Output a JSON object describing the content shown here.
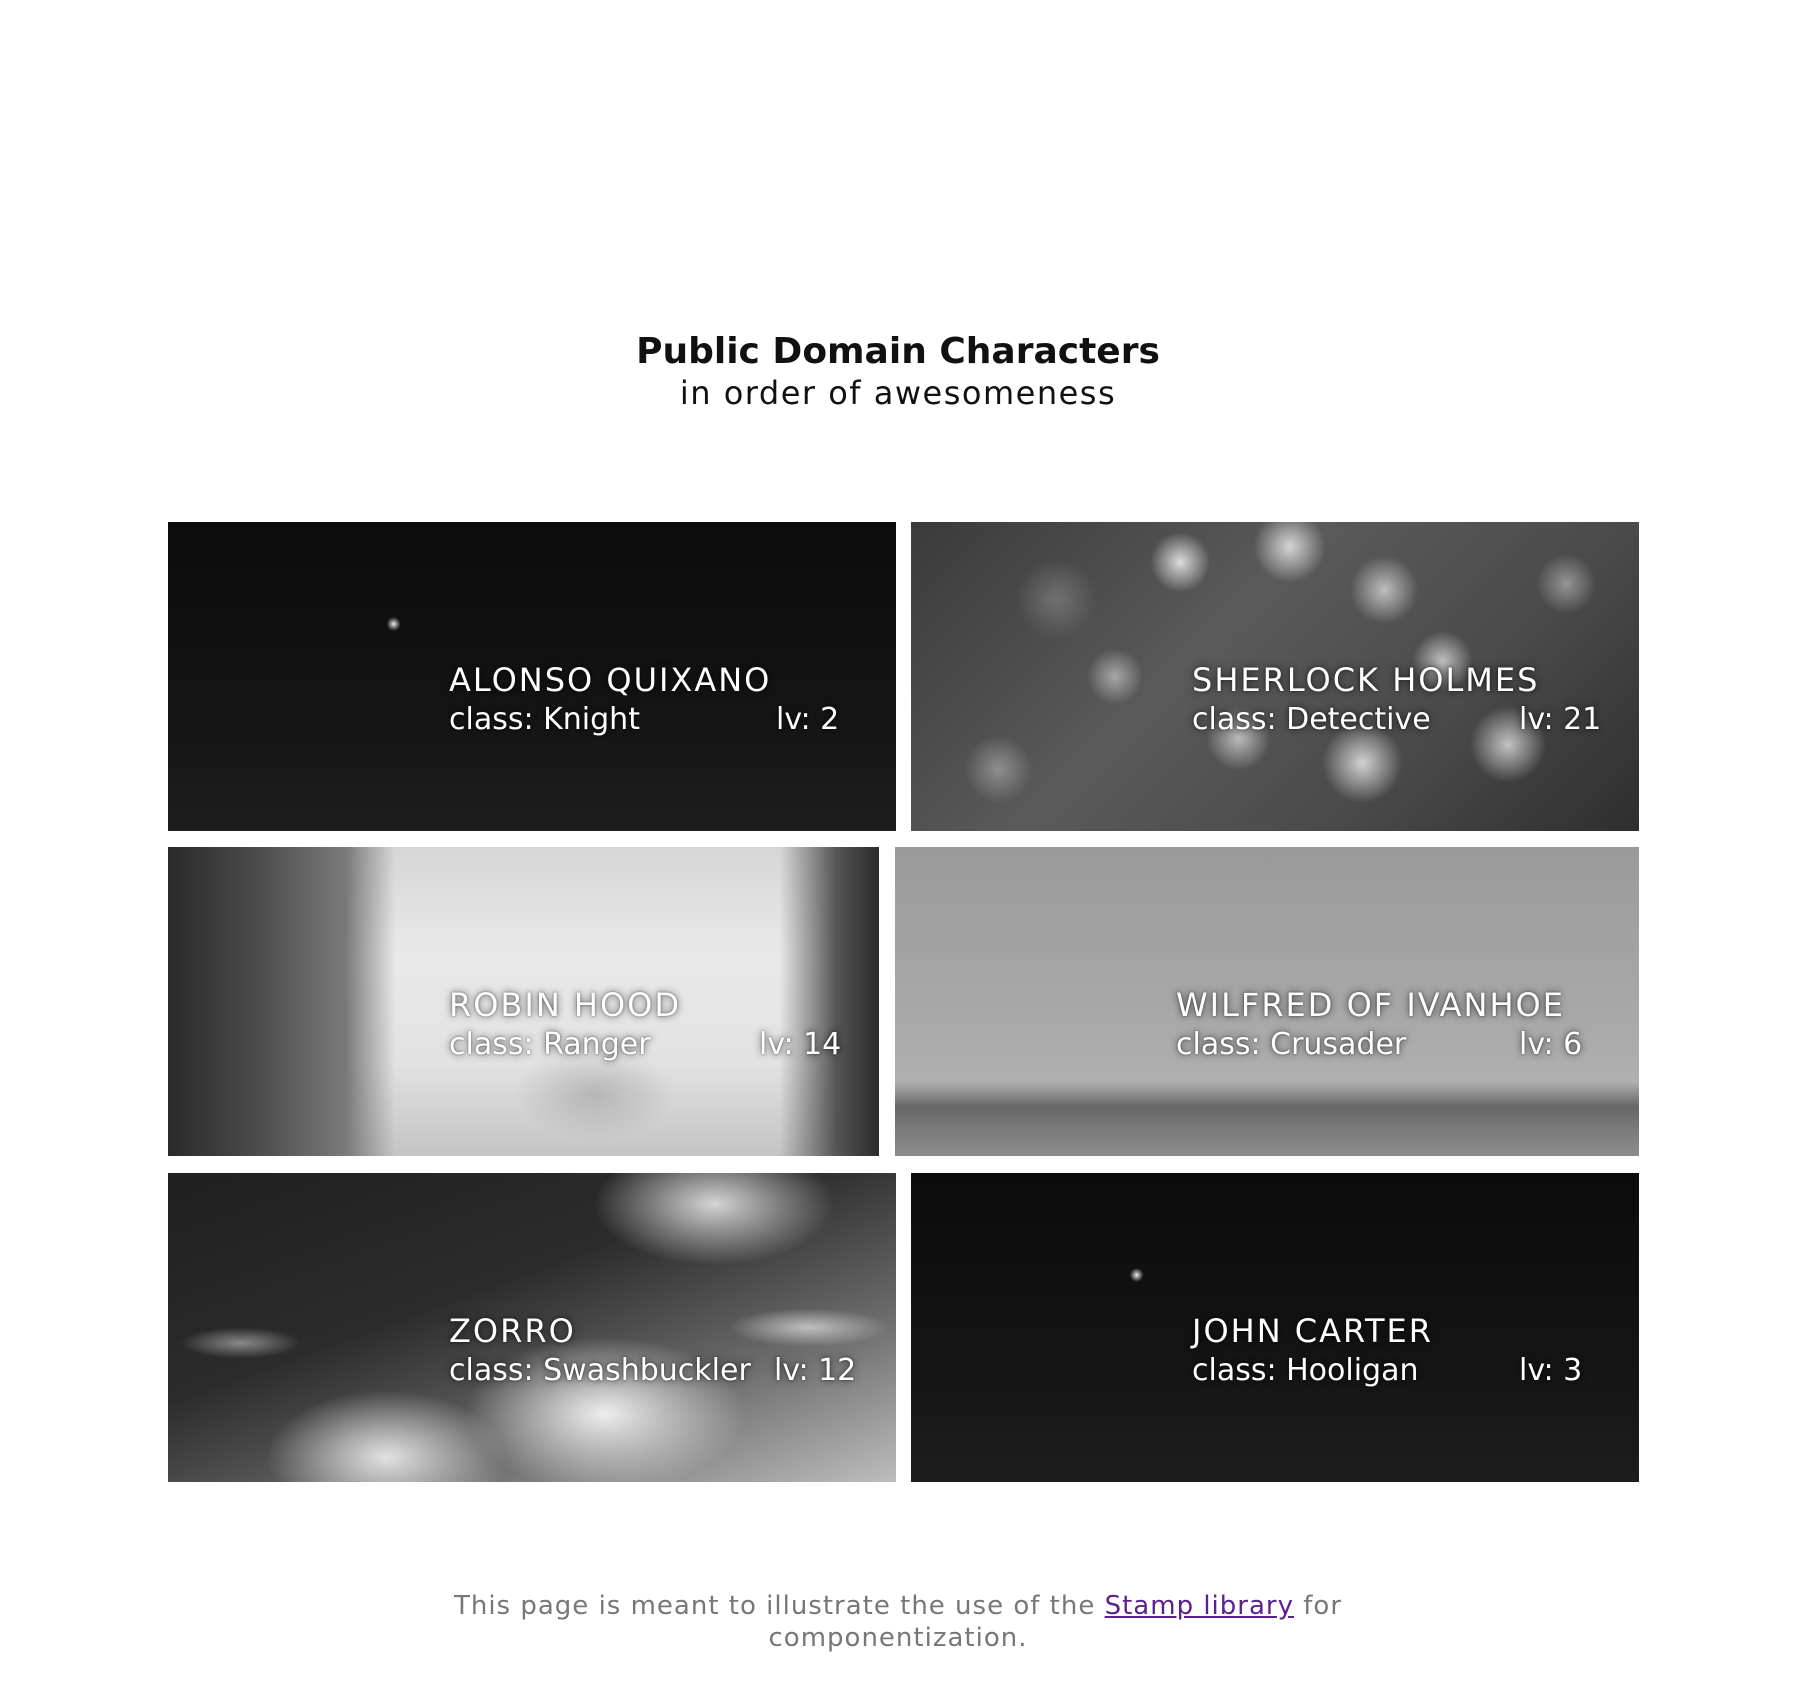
{
  "header": {
    "title": "Public Domain Characters",
    "subtitle": "in order of awesomeness"
  },
  "cards": [
    {
      "name": "ALONSO QUIXANO",
      "class": "class: Knight",
      "level": "lv: 2"
    },
    {
      "name": "SHERLOCK HOLMES",
      "class": "class: Detective",
      "level": "lv: 21"
    },
    {
      "name": "ROBIN HOOD",
      "class": "class: Ranger",
      "level": "lv: 14"
    },
    {
      "name": "WILFRED OF IVANHOE",
      "class": "class: Crusader",
      "level": "lv: 6"
    },
    {
      "name": "ZORRO",
      "class": "class: Swashbuckler",
      "level": "lv: 12"
    },
    {
      "name": "JOHN CARTER",
      "class": "class: Hooligan",
      "level": "lv: 3"
    }
  ],
  "footer": {
    "text_before": "This page is meant to illustrate the use of the",
    "link_label": "Stamp library",
    "text_after": "for",
    "text_line2": "componentization."
  },
  "colors": {
    "link": "#5b1f8f",
    "footer_text": "#777777",
    "card_text": "#ffffff"
  }
}
